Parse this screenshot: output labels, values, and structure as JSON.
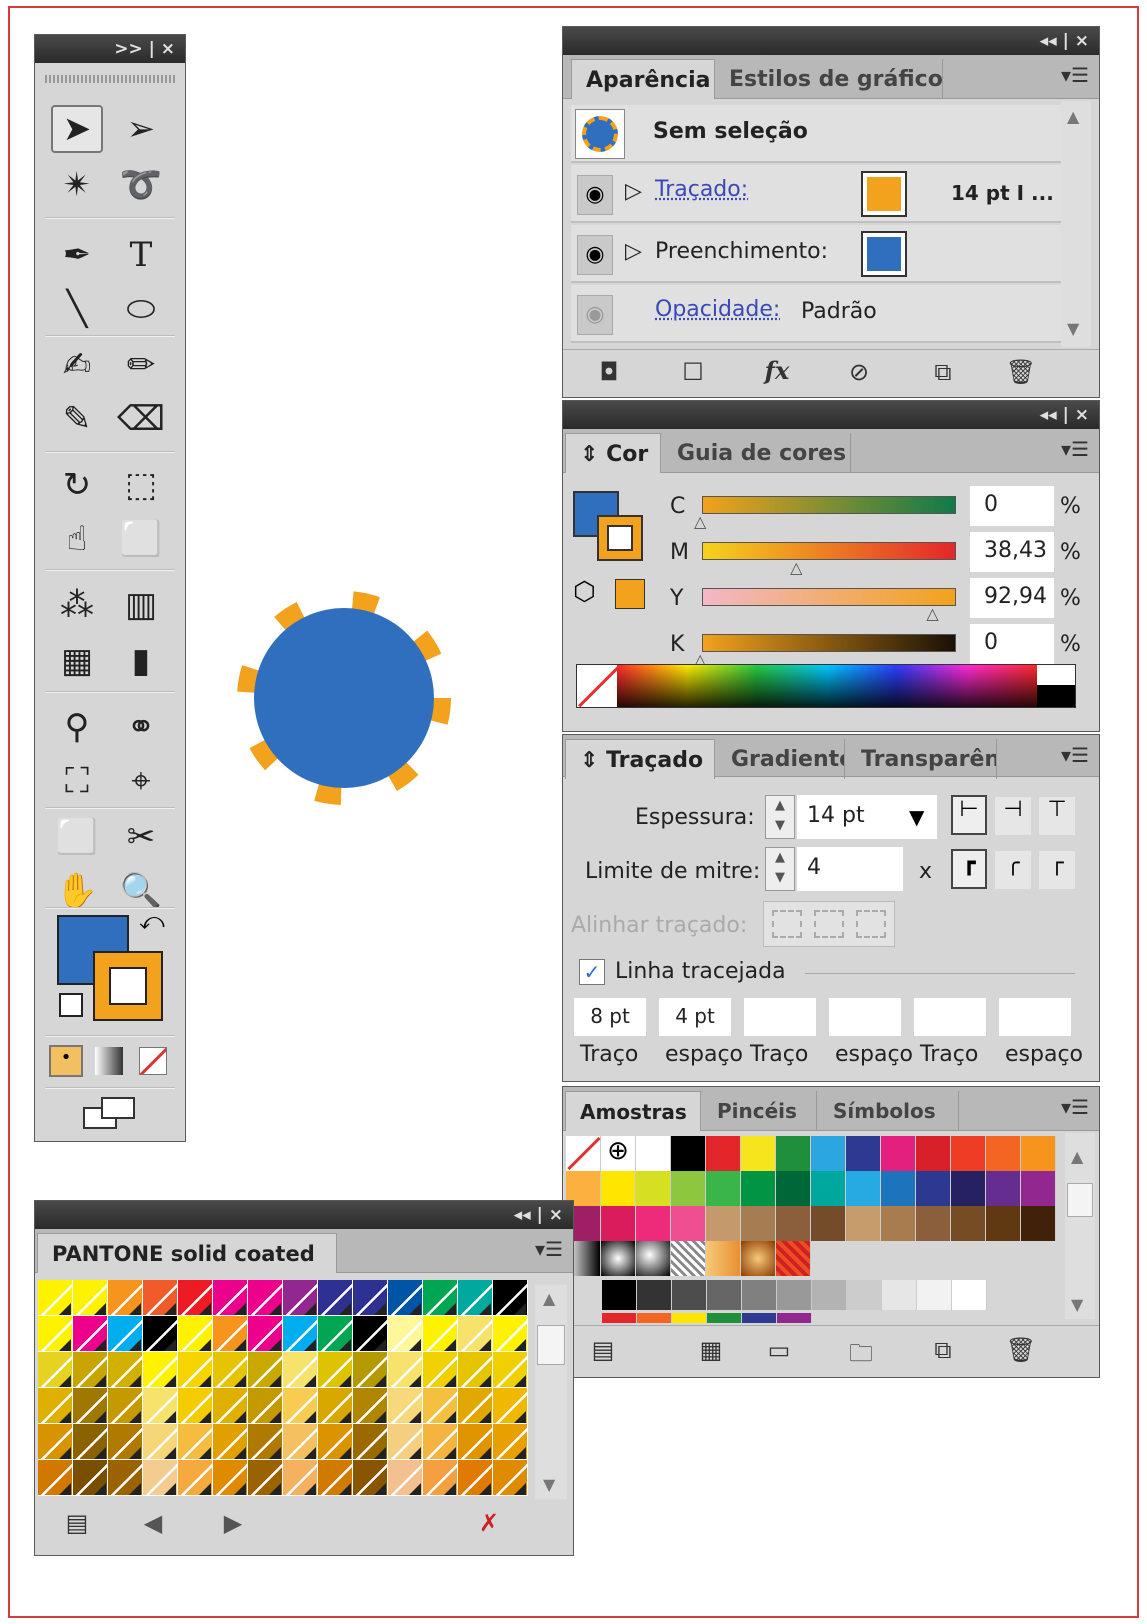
{
  "colors": {
    "fill_blue": "#2f6fbd",
    "stroke_orange": "#f2a21c",
    "panel": "#d6d6d6"
  },
  "tools_panel": {
    "header_glyphs": ">>  |  ×",
    "icons": [
      "selection-tool",
      "direct-selection-tool",
      "magic-wand-tool",
      "lasso-tool",
      "pen-tool",
      "type-tool",
      "line-tool",
      "ellipse-tool",
      "paintbrush-tool",
      "pencil-tool",
      "blob-brush-tool",
      "eraser-tool",
      "rotate-tool",
      "scale-tool",
      "warp-tool",
      "free-transform-tool",
      "symbol-sprayer-tool",
      "column-graph-tool",
      "mesh-tool",
      "gradient-tool",
      "eyedropper-tool",
      "blend-tool",
      "live-paint-bucket-tool",
      "live-paint-selection-tool",
      "artboard-tool",
      "slice-tool",
      "hand-tool",
      "zoom-tool"
    ]
  },
  "appearance_panel": {
    "header_glyphs": "◂◂  |  ×",
    "tabs": [
      "Aparência",
      "Estilos de gráfico"
    ],
    "header_title": "Sem seleção",
    "stroke_label": "Traçado:",
    "stroke_weight": "14 pt  I ...",
    "fill_label": "Preenchimento:",
    "opacity_label": "Opacidade:",
    "opacity_value": "Padrão",
    "fx_label": "fx"
  },
  "color_panel": {
    "header_glyphs": "◂◂  |  ×",
    "tabs": [
      "Cor",
      "Guia de cores"
    ],
    "channels": [
      {
        "name": "C",
        "value": "0",
        "pos": 0.0
      },
      {
        "name": "M",
        "value": "38,43",
        "pos": 0.3843
      },
      {
        "name": "Y",
        "value": "92,94",
        "pos": 0.9294
      },
      {
        "name": "K",
        "value": "0",
        "pos": 0.0
      }
    ],
    "unit": "%"
  },
  "stroke_panel": {
    "tabs": [
      "Traçado",
      "Gradiente",
      "Transparênc"
    ],
    "weight_label": "Espessura:",
    "weight_value": "14 pt",
    "miter_label": "Limite de mitre:",
    "miter_value": "4",
    "miter_x": "x",
    "align_label": "Alinhar traçado:",
    "dashed_label": "Linha tracejada",
    "dash_values": [
      "8 pt",
      "4 pt",
      "",
      "",
      "",
      ""
    ],
    "dash_labels": [
      "Traço",
      "espaço",
      "Traço",
      "espaço",
      "Traço",
      "espaço"
    ]
  },
  "swatches_panel": {
    "tabs": [
      "Amostras",
      "Pincéis",
      "Símbolos"
    ]
  },
  "pantone_panel": {
    "header_glyphs": "◂◂  |  ×",
    "title": "PANTONE solid coated"
  }
}
